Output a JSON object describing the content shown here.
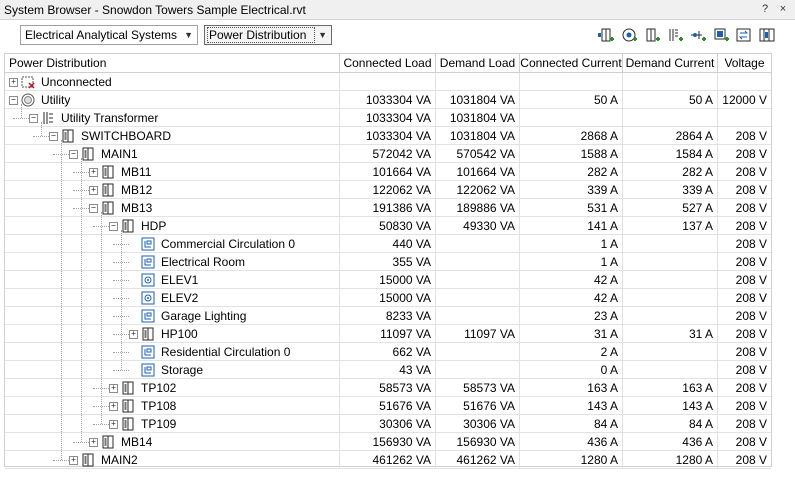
{
  "window": {
    "title": "System Browser - Snowdon Towers Sample Electrical.rvt",
    "help_label": "?",
    "close_label": "×"
  },
  "toolbar": {
    "system_filter": "Electrical Analytical Systems",
    "view_filter": "Power Distribution",
    "icons": [
      "panel-add-icon",
      "circle-target-icon",
      "panel-arrow-icon",
      "transformer-icon",
      "connector-icon",
      "add-element-icon",
      "refresh-icon",
      "settings-grid-icon"
    ]
  },
  "columns": [
    {
      "key": "name",
      "label": "Power Distribution"
    },
    {
      "key": "connected_load",
      "label": "Connected Load"
    },
    {
      "key": "demand_load",
      "label": "Demand Load"
    },
    {
      "key": "connected_current",
      "label": "Connected Current"
    },
    {
      "key": "demand_current",
      "label": "Demand Current"
    },
    {
      "key": "voltage",
      "label": "Voltage"
    }
  ],
  "rows": [
    {
      "name": "Unconnected",
      "level": 0,
      "expander": "+",
      "icon": "unconnected-icon",
      "connected_load": "",
      "demand_load": "",
      "connected_current": "",
      "demand_current": "",
      "voltage": ""
    },
    {
      "name": "Utility",
      "level": 0,
      "expander": "-",
      "icon": "utility-icon",
      "connected_load": "1033304 VA",
      "demand_load": "1031804 VA",
      "connected_current": "50 A",
      "demand_current": "50 A",
      "voltage": "12000 V"
    },
    {
      "name": "Utility Transformer",
      "level": 1,
      "expander": "-",
      "icon": "transformer-icon",
      "connected_load": "1033304 VA",
      "demand_load": "1031804 VA",
      "connected_current": "",
      "demand_current": "",
      "voltage": ""
    },
    {
      "name": "SWITCHBOARD",
      "level": 2,
      "expander": "-",
      "icon": "panel-icon",
      "connected_load": "1033304 VA",
      "demand_load": "1031804 VA",
      "connected_current": "2868 A",
      "demand_current": "2864 A",
      "voltage": "208 V"
    },
    {
      "name": "MAIN1",
      "level": 3,
      "expander": "-",
      "icon": "panel-icon",
      "connected_load": "572042 VA",
      "demand_load": "570542 VA",
      "connected_current": "1588 A",
      "demand_current": "1584 A",
      "voltage": "208 V"
    },
    {
      "name": "MB11",
      "level": 4,
      "expander": "+",
      "icon": "panel-icon",
      "connected_load": "101664 VA",
      "demand_load": "101664 VA",
      "connected_current": "282 A",
      "demand_current": "282 A",
      "voltage": "208 V"
    },
    {
      "name": "MB12",
      "level": 4,
      "expander": "+",
      "icon": "panel-icon",
      "connected_load": "122062 VA",
      "demand_load": "122062 VA",
      "connected_current": "339 A",
      "demand_current": "339 A",
      "voltage": "208 V"
    },
    {
      "name": "MB13",
      "level": 4,
      "expander": "-",
      "icon": "panel-icon",
      "connected_load": "191386 VA",
      "demand_load": "189886 VA",
      "connected_current": "531 A",
      "demand_current": "527 A",
      "voltage": "208 V"
    },
    {
      "name": "HDP",
      "level": 5,
      "expander": "-",
      "icon": "panel-icon",
      "connected_load": "50830 VA",
      "demand_load": "49330 VA",
      "connected_current": "141 A",
      "demand_current": "137 A",
      "voltage": "208 V"
    },
    {
      "name": "Commercial Circulation 0",
      "level": 6,
      "expander": "",
      "icon": "circuit-icon",
      "connected_load": "440 VA",
      "demand_load": "",
      "connected_current": "1 A",
      "demand_current": "",
      "voltage": "208 V"
    },
    {
      "name": "Electrical Room",
      "level": 6,
      "expander": "",
      "icon": "circuit-icon",
      "connected_load": "355 VA",
      "demand_load": "",
      "connected_current": "1 A",
      "demand_current": "",
      "voltage": "208 V"
    },
    {
      "name": "ELEV1",
      "level": 6,
      "expander": "",
      "icon": "equipment-icon",
      "connected_load": "15000 VA",
      "demand_load": "",
      "connected_current": "42 A",
      "demand_current": "",
      "voltage": "208 V"
    },
    {
      "name": "ELEV2",
      "level": 6,
      "expander": "",
      "icon": "equipment-icon",
      "connected_load": "15000 VA",
      "demand_load": "",
      "connected_current": "42 A",
      "demand_current": "",
      "voltage": "208 V"
    },
    {
      "name": "Garage Lighting",
      "level": 6,
      "expander": "",
      "icon": "circuit-icon",
      "connected_load": "8233 VA",
      "demand_load": "",
      "connected_current": "23 A",
      "demand_current": "",
      "voltage": "208 V"
    },
    {
      "name": "HP100",
      "level": 6,
      "expander": "+",
      "icon": "panel-icon",
      "connected_load": "11097 VA",
      "demand_load": "11097 VA",
      "connected_current": "31 A",
      "demand_current": "31 A",
      "voltage": "208 V"
    },
    {
      "name": "Residential Circulation 0",
      "level": 6,
      "expander": "",
      "icon": "circuit-icon",
      "connected_load": "662 VA",
      "demand_load": "",
      "connected_current": "2 A",
      "demand_current": "",
      "voltage": "208 V"
    },
    {
      "name": "Storage",
      "level": 6,
      "expander": "",
      "icon": "circuit-icon",
      "connected_load": "43 VA",
      "demand_load": "",
      "connected_current": "0 A",
      "demand_current": "",
      "voltage": "208 V"
    },
    {
      "name": "TP102",
      "level": 5,
      "expander": "+",
      "icon": "panel-icon",
      "connected_load": "58573 VA",
      "demand_load": "58573 VA",
      "connected_current": "163 A",
      "demand_current": "163 A",
      "voltage": "208 V"
    },
    {
      "name": "TP108",
      "level": 5,
      "expander": "+",
      "icon": "panel-icon",
      "connected_load": "51676 VA",
      "demand_load": "51676 VA",
      "connected_current": "143 A",
      "demand_current": "143 A",
      "voltage": "208 V"
    },
    {
      "name": "TP109",
      "level": 5,
      "expander": "+",
      "icon": "panel-icon",
      "connected_load": "30306 VA",
      "demand_load": "30306 VA",
      "connected_current": "84 A",
      "demand_current": "84 A",
      "voltage": "208 V"
    },
    {
      "name": "MB14",
      "level": 4,
      "expander": "+",
      "icon": "panel-icon",
      "connected_load": "156930 VA",
      "demand_load": "156930 VA",
      "connected_current": "436 A",
      "demand_current": "436 A",
      "voltage": "208 V"
    },
    {
      "name": "MAIN2",
      "level": 3,
      "expander": "+",
      "icon": "panel-icon",
      "connected_load": "461262 VA",
      "demand_load": "461262 VA",
      "connected_current": "1280 A",
      "demand_current": "1280 A",
      "voltage": "208 V"
    }
  ],
  "colors": {
    "accent": "#1a5fb4",
    "icon_stroke": "#2a2a2a",
    "grid_line": "#e2e2e2"
  }
}
